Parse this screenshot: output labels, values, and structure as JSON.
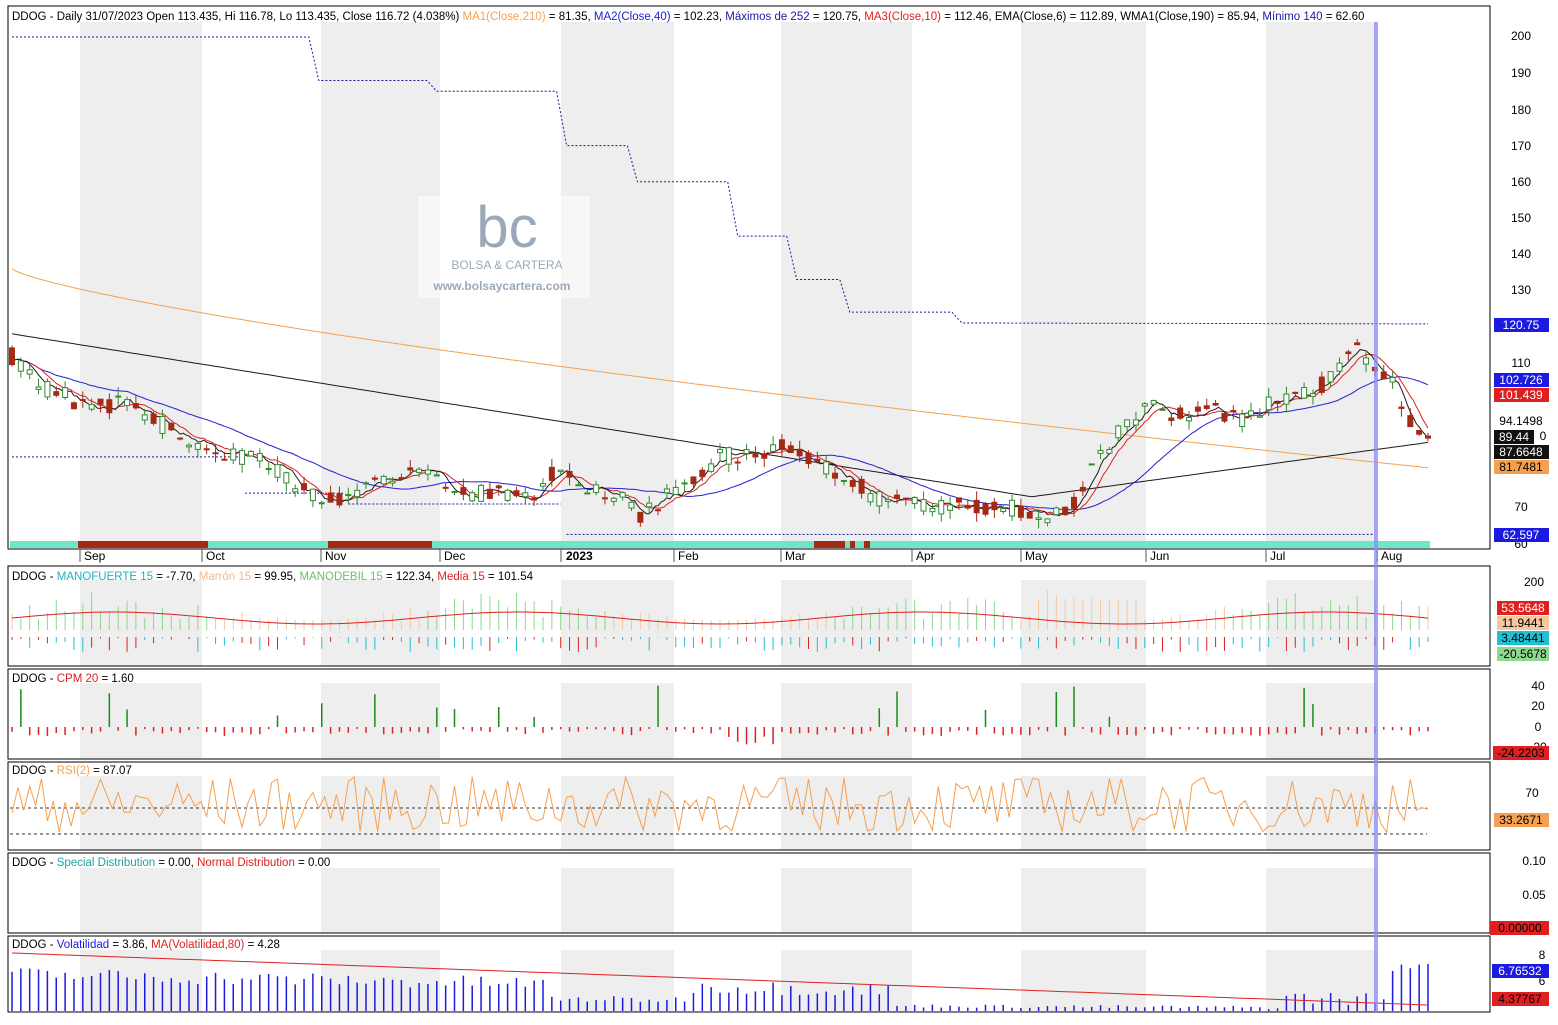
{
  "colors": {
    "bull": "#2e8b2e",
    "bear": "#a52a14",
    "ma210": "#f5a050",
    "ma40": "#2020d0",
    "ma10": "#e02020",
    "ema6": "#1a1a1a",
    "wma190": "#1a1a1a",
    "max252": "#1a1aa0",
    "min140": "#1a1aa0",
    "cursor": "#8a8aff",
    "band_cyan": "#6ae8c8",
    "band_brown": "#a52a14",
    "shade": "#eeeeee"
  },
  "panels": {
    "price": {
      "header_parts": [
        {
          "text": "DDOG - Daily 31/07/2023 Open 113.435, Hi 116.78, Lo 113.435, Close 116.72 (4.038%) ",
          "color": "#000000"
        },
        {
          "text": "MA1(Close,210)",
          "color": "#f5a050"
        },
        {
          "text": " = 81.35, ",
          "color": "#000000"
        },
        {
          "text": "MA2(Close,40)",
          "color": "#2020d0"
        },
        {
          "text": " = 102.23, ",
          "color": "#000000"
        },
        {
          "text": "Máximos de 252",
          "color": "#1a1aa0"
        },
        {
          "text": " = 120.75, ",
          "color": "#000000"
        },
        {
          "text": "MA3(Close,10)",
          "color": "#e02020"
        },
        {
          "text": " = 112.46, EMA(Close,6) = 112.89, WMA1(Close,190) = 85.94, ",
          "color": "#000000"
        },
        {
          "text": "Mínimo 140",
          "color": "#1a1aa0"
        },
        {
          "text": " = 62.60",
          "color": "#000000"
        }
      ],
      "y_ticks": [
        "200",
        "190",
        "180",
        "170",
        "160",
        "150",
        "140",
        "130",
        "110",
        "70",
        "60"
      ],
      "last_value_tags": [
        {
          "value": "120.75",
          "bg": "#1a1ae0",
          "fg": "#ffffff"
        },
        {
          "value": "102.726",
          "bg": "#1a1ae0",
          "fg": "#ffffff"
        },
        {
          "value": "101.439",
          "bg": "#e02020",
          "fg": "#ffffff"
        },
        {
          "value": "94.1498",
          "bg": "#ffffff",
          "fg": "#000000"
        },
        {
          "value": "89.44",
          "bg": "#111111",
          "fg": "#ffffff"
        },
        {
          "value": "87.6648",
          "bg": "#111111",
          "fg": "#ffffff"
        },
        {
          "value": "81.7481",
          "bg": "#f5a050",
          "fg": "#000000"
        },
        {
          "value": "62.597",
          "bg": "#1a1ae0",
          "fg": "#ffffff"
        }
      ],
      "partial_tick": "0",
      "x_labels": [
        "Sep",
        "Oct",
        "Nov",
        "Dec",
        "2023",
        "Feb",
        "Mar",
        "Apr",
        "May",
        "Jun",
        "Jul",
        "Aug"
      ]
    },
    "mano": {
      "header_parts": [
        {
          "text": "DDOG - ",
          "color": "#000000"
        },
        {
          "text": "MANOFUERTE 15",
          "color": "#20b0c0"
        },
        {
          "text": " = -7.70, ",
          "color": "#000000"
        },
        {
          "text": "Marrón 15",
          "color": "#f5b890"
        },
        {
          "text": " = 99.95, ",
          "color": "#000000"
        },
        {
          "text": "MANODEBIL 15",
          "color": "#6cc06c"
        },
        {
          "text": " = 122.34, ",
          "color": "#000000"
        },
        {
          "text": "Media 15",
          "color": "#e02020"
        },
        {
          "text": " = 101.54",
          "color": "#000000"
        }
      ],
      "y_ticks": [
        "200"
      ],
      "tags": [
        {
          "value": "53.5648",
          "bg": "#e02020",
          "fg": "#ffffff"
        },
        {
          "value": "11.9441",
          "bg": "#f5c8a0",
          "fg": "#000000"
        },
        {
          "value": "3.48441",
          "bg": "#20c0d0",
          "fg": "#000000"
        },
        {
          "value": "-20.5678",
          "bg": "#90d890",
          "fg": "#000000"
        }
      ]
    },
    "cpm": {
      "header_parts": [
        {
          "text": "DDOG - ",
          "color": "#000000"
        },
        {
          "text": "CPM 20",
          "color": "#e02020"
        },
        {
          "text": " = 1.60",
          "color": "#000000"
        }
      ],
      "y_ticks": [
        "40",
        "20",
        "0",
        "-20"
      ],
      "tags": [
        {
          "value": "-24.2203",
          "bg": "#e02020",
          "fg": "#000000"
        }
      ]
    },
    "rsi": {
      "header_parts": [
        {
          "text": "DDOG - ",
          "color": "#000000"
        },
        {
          "text": "RSI(2)",
          "color": "#f5a050"
        },
        {
          "text": " = 87.07",
          "color": "#000000"
        }
      ],
      "y_ticks": [
        "70"
      ],
      "tags": [
        {
          "value": "33.2671",
          "bg": "#f5a050",
          "fg": "#000000"
        }
      ]
    },
    "dist": {
      "header_parts": [
        {
          "text": "DDOG - ",
          "color": "#000000"
        },
        {
          "text": "Special Distribution",
          "color": "#20a0a0"
        },
        {
          "text": " = 0.00, ",
          "color": "#000000"
        },
        {
          "text": "Normal Distribution",
          "color": "#e02020"
        },
        {
          "text": " = 0.00",
          "color": "#000000"
        }
      ],
      "y_ticks": [
        "0.10",
        "0.05"
      ],
      "tags": [
        {
          "value": "0.00000",
          "bg": "#e02020",
          "fg": "#000000"
        }
      ]
    },
    "vol": {
      "header_parts": [
        {
          "text": "DDOG - ",
          "color": "#000000"
        },
        {
          "text": "Volatilidad",
          "color": "#1a1ae0"
        },
        {
          "text": " = 3.86, ",
          "color": "#000000"
        },
        {
          "text": "MA(Volatilidad,80)",
          "color": "#e02020"
        },
        {
          "text": " = 4.28",
          "color": "#000000"
        }
      ],
      "y_ticks": [
        "8",
        "6"
      ],
      "tags": [
        {
          "value": "6.76532",
          "bg": "#1a1ae0",
          "fg": "#ffffff"
        },
        {
          "value": "4.37767",
          "bg": "#e02020",
          "fg": "#000000"
        }
      ]
    }
  },
  "watermark": {
    "logo": "bc",
    "name": "BOLSA & CARTERA",
    "url": "www.bolsaycartera.com"
  },
  "chart_data": {
    "type": "candlestick",
    "ylim": [
      57,
      205
    ],
    "x_labels": [
      "Sep",
      "Oct",
      "Nov",
      "Dec",
      "2023",
      "Feb",
      "Mar",
      "Apr",
      "May",
      "Jun",
      "Jul",
      "Aug"
    ],
    "price_knots": [
      [
        0,
        112
      ],
      [
        8,
        104
      ],
      [
        18,
        101
      ],
      [
        26,
        97
      ],
      [
        36,
        99
      ],
      [
        48,
        95
      ],
      [
        56,
        90
      ],
      [
        64,
        88
      ],
      [
        70,
        85
      ],
      [
        78,
        84
      ],
      [
        88,
        82
      ],
      [
        98,
        76
      ],
      [
        106,
        72
      ],
      [
        116,
        72
      ],
      [
        126,
        78
      ],
      [
        134,
        80
      ],
      [
        144,
        79
      ],
      [
        156,
        73
      ],
      [
        166,
        75
      ],
      [
        176,
        72
      ],
      [
        186,
        80
      ],
      [
        196,
        76
      ],
      [
        206,
        74
      ],
      [
        214,
        68
      ],
      [
        224,
        73
      ],
      [
        232,
        77
      ],
      [
        242,
        84
      ],
      [
        252,
        85
      ],
      [
        262,
        87
      ],
      [
        270,
        85
      ],
      [
        280,
        80
      ],
      [
        290,
        76
      ],
      [
        298,
        71
      ],
      [
        308,
        71
      ],
      [
        318,
        70
      ],
      [
        328,
        71
      ],
      [
        338,
        70
      ],
      [
        348,
        69
      ],
      [
        356,
        68
      ],
      [
        362,
        70
      ],
      [
        370,
        82
      ],
      [
        380,
        92
      ],
      [
        390,
        98
      ],
      [
        400,
        95
      ],
      [
        410,
        97
      ],
      [
        420,
        94
      ],
      [
        430,
        99
      ],
      [
        440,
        100
      ],
      [
        450,
        105
      ],
      [
        456,
        113
      ],
      [
        460,
        114
      ],
      [
        466,
        108
      ],
      [
        472,
        105
      ],
      [
        476,
        97
      ],
      [
        480,
        91
      ],
      [
        484,
        88
      ]
    ],
    "max252_steps": [
      [
        0,
        200
      ],
      [
        104,
        188
      ],
      [
        144,
        185
      ],
      [
        188,
        170
      ],
      [
        212,
        160
      ],
      [
        246,
        145
      ],
      [
        266,
        133
      ],
      [
        284,
        124
      ],
      [
        322,
        121
      ]
    ],
    "max252_end": 120.75,
    "min140": 62.6,
    "min_segments": [
      [
        0,
        78,
        84
      ],
      [
        79,
        113,
        74
      ],
      [
        114,
        186,
        71
      ],
      [
        188,
        462,
        62.6
      ]
    ],
    "last_values": {
      "ma10": 101.439,
      "ma40": 102.726,
      "ma210": 81.7481,
      "wma190": 87.6648,
      "max252": 120.75,
      "min140": 62.597
    }
  }
}
